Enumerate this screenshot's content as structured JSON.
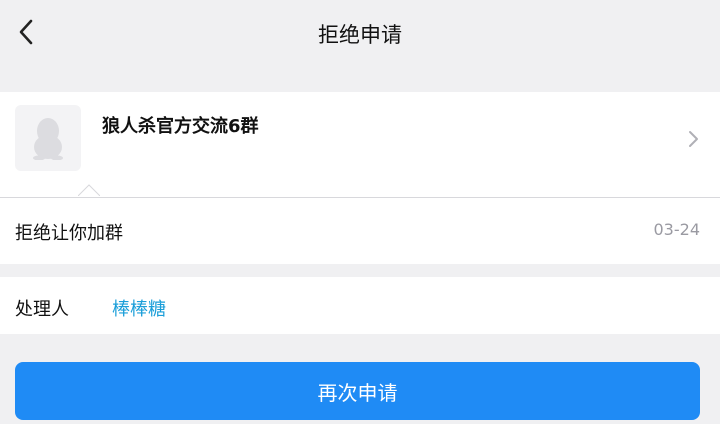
{
  "header": {
    "title": "拒绝申请",
    "back_icon": "chevron-left-icon"
  },
  "group": {
    "name": "狼人杀官方交流6群",
    "avatar_icon": "penguin-avatar-icon"
  },
  "request": {
    "status_text": "拒绝让你加群",
    "date": "03-24"
  },
  "handler": {
    "label": "处理人",
    "name": "棒棒糖"
  },
  "actions": {
    "reapply_label": "再次申请"
  },
  "colors": {
    "accent": "#1f8bf5",
    "link": "#1a9ed9",
    "background": "#f0f0f2"
  }
}
